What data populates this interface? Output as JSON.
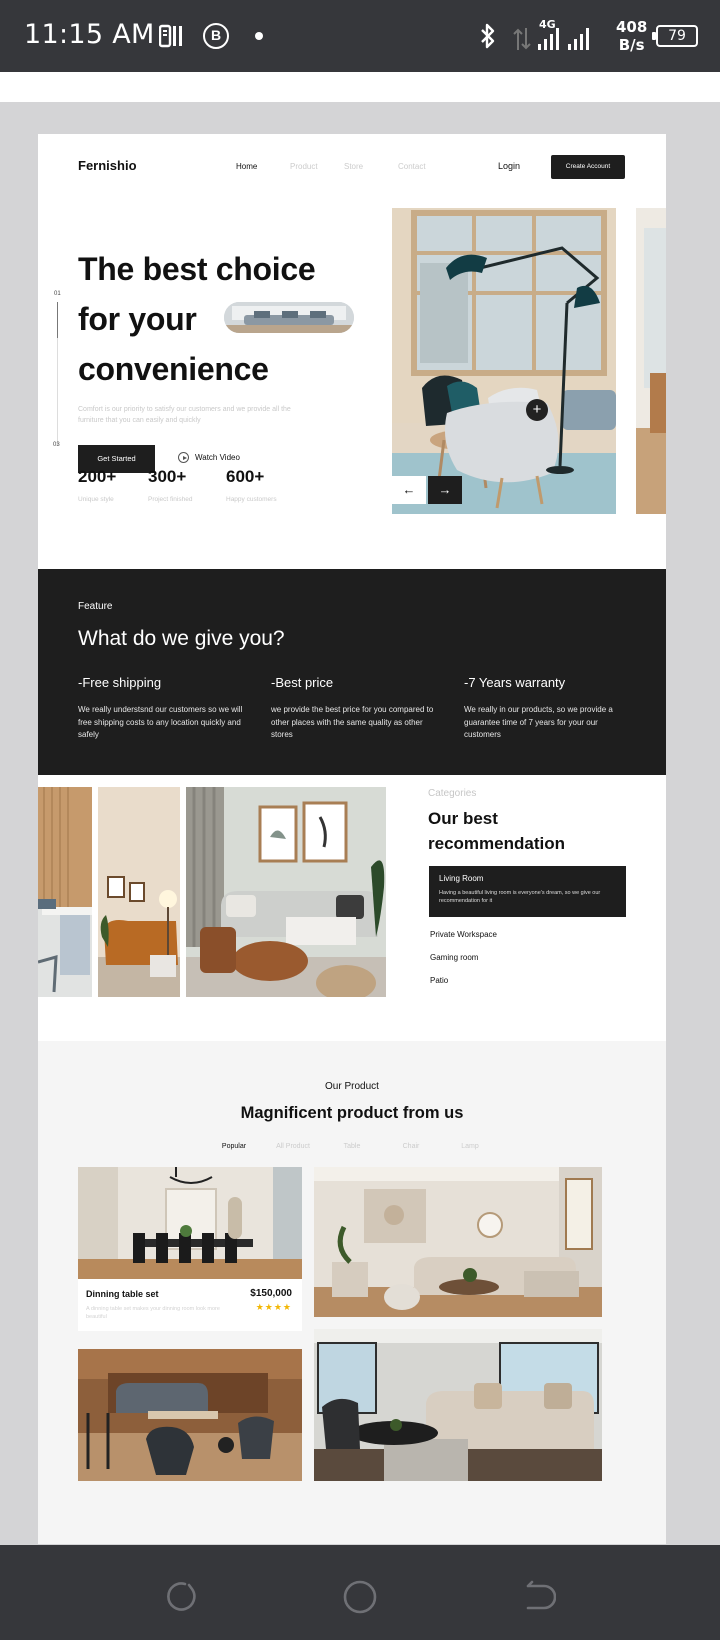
{
  "status_bar": {
    "time": "11:15 AM",
    "app_icon": "parking-app-icon",
    "b_icon_label": "B",
    "network_type": "4G",
    "speed_value": "408",
    "speed_unit": "B/s",
    "battery": "79"
  },
  "site": {
    "logo": "Fernishio",
    "nav_links": [
      "Home",
      "Product",
      "Store",
      "Contact"
    ],
    "login": "Login",
    "create_account": "Create Account"
  },
  "hero": {
    "title_line1": "The best choice",
    "title_line2": "for your",
    "title_line3": "convenience",
    "description": "Comfort is our priority to satisfy our customers and we provide all the furniture that you can easily and quickly",
    "get_started": "Get Started",
    "watch_video": "Watch Video",
    "slide_start": "01",
    "slide_end": "03",
    "stats": [
      {
        "value": "200+",
        "label": "Unique style"
      },
      {
        "value": "300+",
        "label": "Project finished"
      },
      {
        "value": "600+",
        "label": "Happy customers"
      }
    ],
    "prev_arrow": "←",
    "next_arrow": "→",
    "plus": "+"
  },
  "feature": {
    "eyebrow": "Feature",
    "title": "What do we give you?",
    "items": [
      {
        "title": "-Free shipping",
        "text": "We really understsnd our customers so we will free shipping costs to any location quickly and safely"
      },
      {
        "title": "-Best price",
        "text": "we provide the best price for you compared to other places with the same quality as other stores"
      },
      {
        "title": "-7 Years warranty",
        "text": "We really in our products, so we provide a guarantee time of 7 years for your our customers"
      }
    ]
  },
  "categories": {
    "eyebrow": "Categories",
    "title_line1": "Our best",
    "title_line2": "recommendation",
    "active": {
      "title": "Living Room",
      "text": "Having a beautiful living room is everyone's dream, so we give our recommendation for it"
    },
    "items": [
      "Private Workspace",
      "Gaming room",
      "Patio"
    ]
  },
  "products": {
    "eyebrow": "Our Product",
    "title": "Magnificent product from us",
    "tabs": [
      "Popular",
      "All Product",
      "Table",
      "Chair",
      "Lamp"
    ],
    "featured": {
      "name": "Dinning table set",
      "price": "$150,000",
      "stars": "★★★★",
      "description": "A dinning table set makes your dinning room look more beautiful"
    }
  },
  "colors": {
    "dark": "#1e1e1e",
    "status_bar": "#36373b",
    "star": "#f2b705"
  }
}
